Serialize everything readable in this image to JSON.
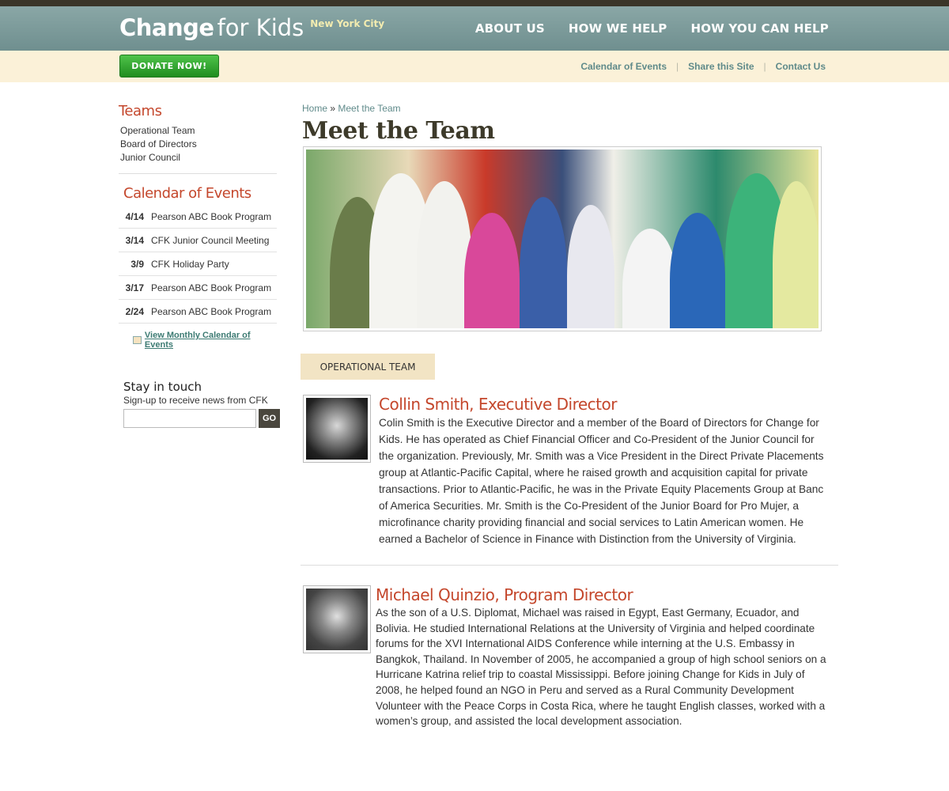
{
  "header": {
    "logo_main": "Change",
    "logo_rest": "for Kids",
    "city": "New York City",
    "nav": [
      "ABOUT US",
      "HOW WE HELP",
      "HOW YOU CAN HELP"
    ]
  },
  "subbar": {
    "donate_label": "DONATE NOW!",
    "links": [
      "Calendar of Events",
      "Share this Site",
      "Contact Us"
    ],
    "separator": "|"
  },
  "sidebar": {
    "teams_heading": "Teams",
    "teams": [
      "Operational Team",
      "Board of Directors",
      "Junior Council"
    ],
    "calendar_heading": "Calendar of Events",
    "events": [
      {
        "date": "4/14",
        "title": "Pearson ABC Book Program"
      },
      {
        "date": "3/14",
        "title": "CFK Junior Council Meeting"
      },
      {
        "date": "3/9",
        "title": "CFK Holiday Party"
      },
      {
        "date": "3/17",
        "title": "Pearson ABC Book Program"
      },
      {
        "date": "2/24",
        "title": "Pearson ABC Book Program"
      }
    ],
    "view_calendar": "View Monthly Calendar of Events",
    "stay_heading": "Stay in touch",
    "stay_sub": "Sign-up to receive news from CFK",
    "email_value": "",
    "go_label": "GO"
  },
  "main": {
    "breadcrumb": [
      "Home",
      "Meet the Team"
    ],
    "breadcrumb_sep": "»",
    "title": "Meet the Team",
    "section_tab": "OPERATIONAL TEAM",
    "people": [
      {
        "name": "Collin Smith,",
        "role": "Executive Director",
        "bio": "Colin Smith is the Executive Director and a member of the Board of Directors for Change for Kids. He has operated as Chief Financial Officer and Co-President of the Junior Council for the organization. Previously, Mr. Smith was a Vice President in the Direct Private Placements group at Atlantic-Pacific Capital, where he raised growth and acquisition capital for private transactions. Prior to Atlantic-Pacific, he was in the Private Equity Placements Group at Banc of America Securities. Mr. Smith is the Co-President of the Junior Board for Pro Mujer, a microfinance charity providing financial and social services to Latin American women. He earned a Bachelor of Science in Finance with Distinction from the University of Virginia."
      },
      {
        "name": "Michael Quinzio,",
        "role": "Program Director",
        "bio": "As the son of a U.S. Diplomat, Michael was raised in Egypt, East Germany, Ecuador, and Bolivia. He studied International Relations at the University of Virginia and helped coordinate forums for the XVI International AIDS Conference while interning at the U.S. Embassy in Bangkok, Thailand. In November of 2005, he accompanied a group of high school seniors on a Hurricane Katrina relief trip to coastal Mississippi. Before joining Change for Kids in July of 2008, he helped found an NGO in Peru and served as a Rural Community Development Volunteer with the Peace Corps in Costa Rica, where he taught English classes, worked with a women’s group, and assisted the local development association."
      }
    ]
  }
}
